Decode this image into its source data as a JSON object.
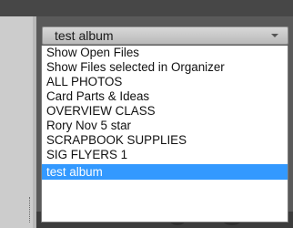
{
  "album_select": {
    "value": "test album",
    "options": [
      "Show Open Files",
      "Show Files selected in Organizer",
      "ALL PHOTOS",
      "Card Parts & Ideas",
      "OVERVIEW CLASS",
      "Rory Nov 5 star",
      "SCRAPBOOK SUPPLIES",
      "SIG FLYERS 1",
      "test album"
    ],
    "selected_option": "test album"
  },
  "colors": {
    "highlight": "#3399ff",
    "background": "#5a5a5a"
  },
  "icons": [
    "chevron-down-icon"
  ]
}
